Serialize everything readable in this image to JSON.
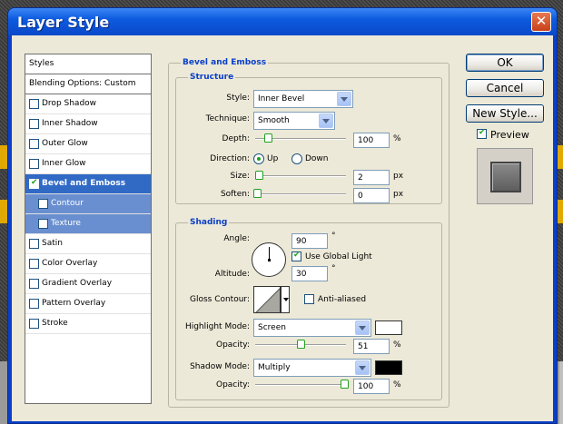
{
  "window": {
    "title": "Layer Style",
    "close_glyph": "✕"
  },
  "styles_list": {
    "items": [
      {
        "label": "Styles",
        "type": "header"
      },
      {
        "label": "Blending Options: Custom",
        "type": "header"
      },
      {
        "label": "Drop Shadow",
        "checked": false
      },
      {
        "label": "Inner Shadow",
        "checked": false
      },
      {
        "label": "Outer Glow",
        "checked": false
      },
      {
        "label": "Inner Glow",
        "checked": false
      },
      {
        "label": "Bevel and Emboss",
        "checked": true,
        "selected": true
      },
      {
        "label": "Contour",
        "checked": false,
        "sub": true
      },
      {
        "label": "Texture",
        "checked": false,
        "sub": true
      },
      {
        "label": "Satin",
        "checked": false
      },
      {
        "label": "Color Overlay",
        "checked": false
      },
      {
        "label": "Gradient Overlay",
        "checked": false
      },
      {
        "label": "Pattern Overlay",
        "checked": false
      },
      {
        "label": "Stroke",
        "checked": false
      }
    ]
  },
  "bevel": {
    "title": "Bevel and Emboss",
    "structure": {
      "title": "Structure",
      "style_label": "Style:",
      "style_value": "Inner Bevel",
      "technique_label": "Technique:",
      "technique_value": "Smooth",
      "depth_label": "Depth:",
      "depth_value": "100",
      "depth_unit": "%",
      "direction_label": "Direction:",
      "direction_up": "Up",
      "direction_down": "Down",
      "direction_selected": "Up",
      "size_label": "Size:",
      "size_value": "2",
      "size_unit": "px",
      "soften_label": "Soften:",
      "soften_value": "0",
      "soften_unit": "px"
    },
    "shading": {
      "title": "Shading",
      "angle_label": "Angle:",
      "angle_value": "90",
      "angle_unit": "°",
      "global_light_label": "Use Global Light",
      "global_light_checked": true,
      "altitude_label": "Altitude:",
      "altitude_value": "30",
      "altitude_unit": "°",
      "gloss_label": "Gloss Contour:",
      "anti_aliased_label": "Anti-aliased",
      "anti_aliased_checked": false,
      "highlight_mode_label": "Highlight Mode:",
      "highlight_mode_value": "Screen",
      "highlight_color": "#ffffff",
      "highlight_opacity_label": "Opacity:",
      "highlight_opacity_value": "51",
      "highlight_opacity_unit": "%",
      "shadow_mode_label": "Shadow Mode:",
      "shadow_mode_value": "Multiply",
      "shadow_color": "#000000",
      "shadow_opacity_label": "Opacity:",
      "shadow_opacity_value": "100",
      "shadow_opacity_unit": "%"
    }
  },
  "buttons": {
    "ok": "OK",
    "cancel": "Cancel",
    "new_style": "New Style..."
  },
  "preview": {
    "label": "Preview",
    "checked": true
  }
}
